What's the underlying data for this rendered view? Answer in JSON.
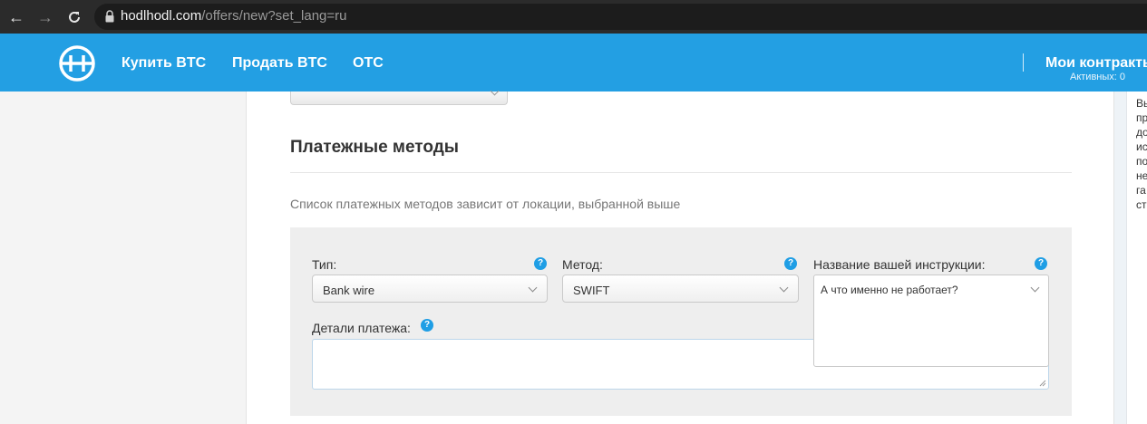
{
  "browser": {
    "url_host": "hodlhodl.com",
    "url_path": "/offers/new?set_lang=ru"
  },
  "header": {
    "nav": [
      "Купить BTC",
      "Продать BTC",
      "OTC"
    ],
    "contracts_label": "Мои контракты",
    "contracts_active": "Активных: 0",
    "brand_color": "#239fe3"
  },
  "right_card_lines": [
    "Вы",
    "пр",
    "до",
    "ис",
    "по",
    "не",
    "га",
    "ст"
  ],
  "payment_section": {
    "title": "Платежные методы",
    "description": "Список платежных методов зависит от локации, выбранной выше",
    "type_label": "Тип:",
    "type_value": "Bank wire",
    "method_label": "Метод:",
    "method_value": "SWIFT",
    "instruction_label": "Название вашей инструкции:",
    "instruction_value": "А что именно не работает?",
    "details_label": "Детали платежа:",
    "help_glyph": "?"
  }
}
